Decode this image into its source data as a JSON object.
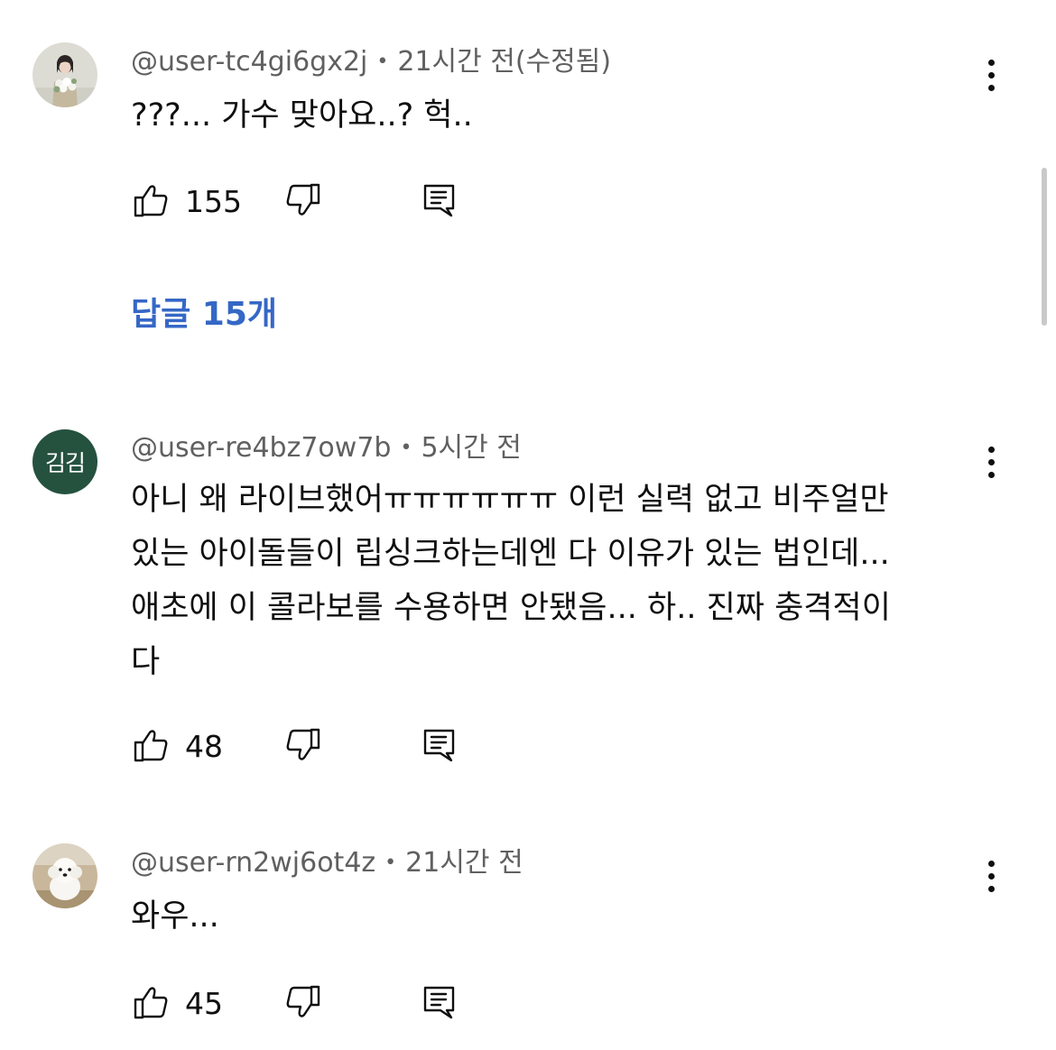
{
  "comments": [
    {
      "author": "@user-tc4gi6gx2j",
      "time": "21시간 전(수정됨)",
      "lines": [
        "???... 가수 맞아요..? 헉.."
      ],
      "likes": "155",
      "avatar_icon": "woman-with-flowers-photo"
    },
    {
      "author": "@user-re4bz7ow7b",
      "time": "5시간 전",
      "lines": [
        "아니 왜 라이브했어ㅠㅠㅠㅠㅠㅠ 이런 실력 없고 비주얼만",
        "있는 아이돌들이 립싱크하는데엔 다 이유가 있는 법인데...",
        "애초에 이 콜라보를 수용하면 안됐음... 하.. 진짜 충격적이",
        "다"
      ],
      "likes": "48",
      "avatar_text": "김김",
      "avatar_color": "#25523f"
    },
    {
      "author": "@user-rn2wj6ot4z",
      "time": "21시간 전",
      "lines": [
        "와우..."
      ],
      "likes": "45",
      "avatar_icon": "white-dog-photo"
    }
  ],
  "replies_label": "답글 15개",
  "separator": "•",
  "colors": {
    "text": "#0f0f0f",
    "meta": "#606060",
    "reply_link": "#3567c6",
    "scrollbar": "#c9c9c9"
  },
  "icons": [
    "thumbs-up-icon",
    "thumbs-down-icon",
    "reply-icon",
    "more-options-icon"
  ]
}
